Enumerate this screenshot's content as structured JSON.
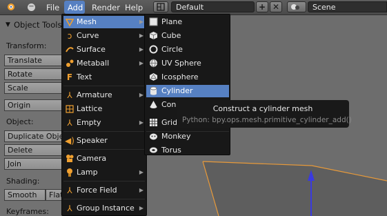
{
  "header": {
    "menus": [
      "File",
      "Add",
      "Render",
      "Help"
    ],
    "layout_value": "Default",
    "scene_value": "Scene"
  },
  "toolshelf": {
    "title": "Object Tools",
    "transform_label": "Transform:",
    "translate": "Translate",
    "rotate": "Rotate",
    "scale": "Scale",
    "origin": "Origin",
    "object_label": "Object:",
    "duplicate": "Duplicate Objects",
    "delete": "Delete",
    "join": "Join",
    "shading_label": "Shading:",
    "smooth": "Smooth",
    "flat": "Flat",
    "keyframes_label": "Keyframes:"
  },
  "add_menu": [
    {
      "label": "Mesh",
      "icon": "mesh-icon"
    },
    {
      "label": "Curve",
      "icon": "curve-icon"
    },
    {
      "label": "Surface",
      "icon": "surface-icon"
    },
    {
      "label": "Metaball",
      "icon": "metaball-icon"
    },
    {
      "label": "Text",
      "icon": "text-icon"
    },
    {
      "label": "Armature",
      "icon": "armature-icon"
    },
    {
      "label": "Lattice",
      "icon": "lattice-icon"
    },
    {
      "label": "Empty",
      "icon": "empty-icon"
    },
    {
      "label": "Speaker",
      "icon": "speaker-icon"
    },
    {
      "label": "Camera",
      "icon": "camera-icon"
    },
    {
      "label": "Lamp",
      "icon": "lamp-icon"
    },
    {
      "label": "Force Field",
      "icon": "force-field-icon"
    },
    {
      "label": "Group Instance",
      "icon": "group-instance-icon"
    }
  ],
  "mesh_menu": [
    {
      "label": "Plane",
      "icon": "plane-icon"
    },
    {
      "label": "Cube",
      "icon": "cube-icon"
    },
    {
      "label": "Circle",
      "icon": "circle-icon"
    },
    {
      "label": "UV Sphere",
      "icon": "uv-sphere-icon"
    },
    {
      "label": "Icosphere",
      "icon": "icosphere-icon"
    },
    {
      "label": "Cylinder",
      "icon": "cylinder-icon"
    },
    {
      "label": "Cone",
      "icon": "cone-icon"
    },
    {
      "label": "Grid",
      "icon": "grid-icon"
    },
    {
      "label": "Monkey",
      "icon": "monkey-icon"
    },
    {
      "label": "Torus",
      "icon": "torus-icon"
    }
  ],
  "tooltip": {
    "title": "Construct a cylinder mesh",
    "python": "Python: bpy.ops.mesh.primitive_cylinder_add()"
  },
  "colors": {
    "highlight": "#5680c2",
    "selected_edge": "#e89a3a",
    "axis_arrow": "#3a3ae0"
  }
}
